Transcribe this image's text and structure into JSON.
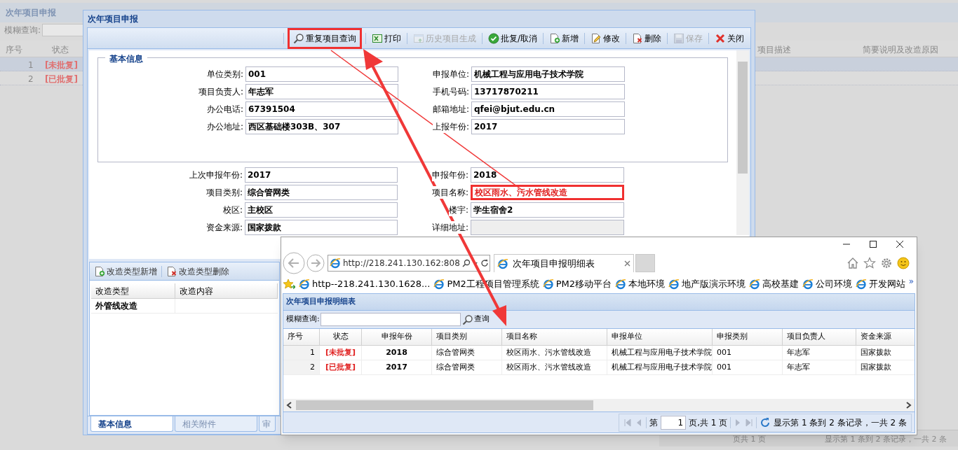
{
  "background": {
    "title": "次年项目申报",
    "search_label": "模糊查询:",
    "columns": [
      "序号",
      "状态",
      "项目描述",
      "简要说明及改造原因"
    ],
    "rows": [
      {
        "index": "1",
        "status": "[未批复]",
        "selected": true
      },
      {
        "index": "2",
        "status": "[已批复]",
        "selected": false
      }
    ],
    "pager_text": "页共 1 页",
    "pager_info": "显示第 1 条到 2 条记录，一共 2 条"
  },
  "dialog": {
    "title": "次年项目申报",
    "toolbar": [
      {
        "label": "重复项目查询",
        "kind": "search",
        "disabled": false,
        "annotated": true
      },
      {
        "label": "打印",
        "kind": "excel",
        "disabled": false,
        "annotated": false
      },
      {
        "label": "历史项目生成",
        "kind": "history",
        "disabled": true,
        "annotated": false
      },
      {
        "label": "批复/取消",
        "kind": "check",
        "disabled": false,
        "annotated": false
      },
      {
        "label": "新增",
        "kind": "add",
        "disabled": false,
        "annotated": false
      },
      {
        "label": "修改",
        "kind": "edit",
        "disabled": false,
        "annotated": false
      },
      {
        "label": "删除",
        "kind": "delete",
        "disabled": false,
        "annotated": false
      },
      {
        "label": "保存",
        "kind": "save",
        "disabled": true,
        "annotated": false
      },
      {
        "label": "关闭",
        "kind": "close",
        "disabled": false,
        "annotated": false
      }
    ],
    "section_title": "基本信息",
    "fields_top": [
      {
        "label": "单位类别:",
        "value": "001"
      },
      {
        "label": "申报单位:",
        "value": "机械工程与应用电子技术学院"
      },
      {
        "label": "项目负责人:",
        "value": "年志军"
      },
      {
        "label": "手机号码:",
        "value": "13717870211"
      },
      {
        "label": "办公电话:",
        "value": "67391504"
      },
      {
        "label": "邮箱地址:",
        "value": "qfei@bjut.edu.cn"
      },
      {
        "label": "办公地址:",
        "value": "西区基础楼303B、307"
      },
      {
        "label": "上报年份:",
        "value": "2017"
      }
    ],
    "fields_bottom": [
      {
        "label": "上次申报年份:",
        "value": "2017",
        "emphasis": false,
        "annotated": false
      },
      {
        "label": "申报年份:",
        "value": "2018",
        "emphasis": false,
        "annotated": false
      },
      {
        "label": "项目类别:",
        "value": "综合管网类",
        "emphasis": false,
        "annotated": false
      },
      {
        "label": "项目名称:",
        "value": "校区雨水、污水管线改造",
        "emphasis": true,
        "annotated": true
      },
      {
        "label": "校区:",
        "value": "主校区",
        "emphasis": false,
        "annotated": false
      },
      {
        "label": "楼宇:",
        "value": "学生宿舍2",
        "emphasis": false,
        "annotated": false
      },
      {
        "label": "资金来源:",
        "value": "国家拨款",
        "emphasis": false,
        "annotated": false
      },
      {
        "label": "详细地址:",
        "annotated": false
      }
    ],
    "detail_toolbar": [
      {
        "label": "改造类型新增",
        "kind": "add"
      },
      {
        "label": "改造类型删除",
        "kind": "delete"
      }
    ],
    "detail_columns": [
      "改造类型",
      "改造内容"
    ],
    "detail_rows": [
      {
        "type": "外管线改造"
      }
    ],
    "tabs": [
      {
        "label": "基本信息",
        "selected": true
      },
      {
        "label": "相关附件",
        "selected": false
      },
      {
        "label": "审",
        "selected": false
      }
    ]
  },
  "browser": {
    "address": "http://218.241.130.162:808",
    "tab_title": "次年项目申报明细表",
    "favorites": [
      "http--218.241.130.1628...",
      "PM2工程项目管理系统",
      "PM2移动平台",
      "本地环境",
      "地产版演示环境",
      "高校基建",
      "公司环境",
      "开发网站"
    ],
    "more": "»",
    "page": {
      "title": "次年项目申报明细表",
      "search_label": "模糊查询:",
      "search_button": "查询",
      "columns": [
        "序号",
        "状态",
        "申报年份",
        "项目类别",
        "项目名称",
        "申报单位",
        "申报类别",
        "项目负责人",
        "资金来源"
      ],
      "rows": [
        [
          "1",
          "[未批复]",
          "2018",
          "综合管网类",
          "校区雨水、污水管线改造",
          "机械工程与应用电子技术学院",
          "001",
          "年志军",
          "国家拨款"
        ],
        [
          "2",
          "[已批复]",
          "2017",
          "综合管网类",
          "校区雨水、污水管线改造",
          "机械工程与应用电子技术学院",
          "001",
          "年志军",
          "国家拨款"
        ]
      ],
      "pager": {
        "prefix": "第",
        "page": "1",
        "suffix": "页,共 1 页",
        "info": "显示第 1 条到 2 条记录，一共 2 条"
      }
    }
  }
}
